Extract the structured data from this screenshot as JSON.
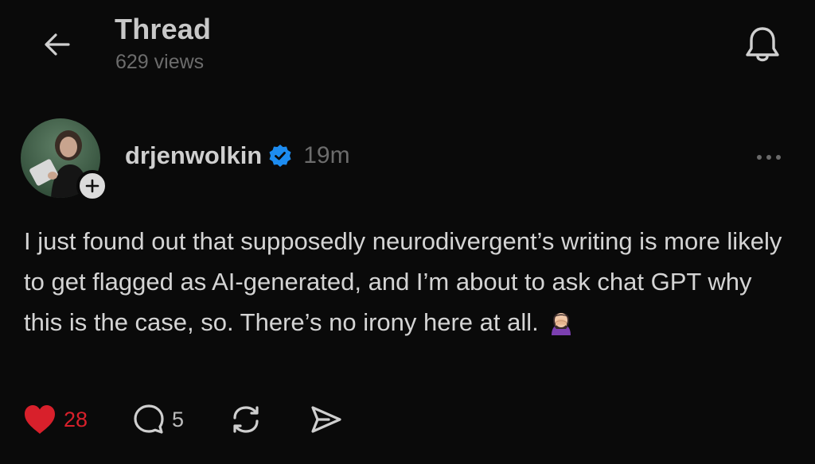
{
  "header": {
    "title": "Thread",
    "views": "629 views",
    "back_icon": "arrow-left-icon",
    "bell_icon": "bell-icon"
  },
  "post": {
    "username": "drjenwolkin",
    "verified": true,
    "timestamp": "19m",
    "text": "I just found out that supposedly neurodivergent’s writing is more likely to get flagged as AI-generated, and I’m about to ask chat GPT why this is the case, so. There’s no irony here at all.",
    "emoji": "woman-facepalming-icon",
    "likes": "28",
    "replies": "5",
    "liked": true
  },
  "colors": {
    "background": "#0a0a0a",
    "like_red": "#d8202b",
    "verified_blue": "#1d8cf0"
  }
}
